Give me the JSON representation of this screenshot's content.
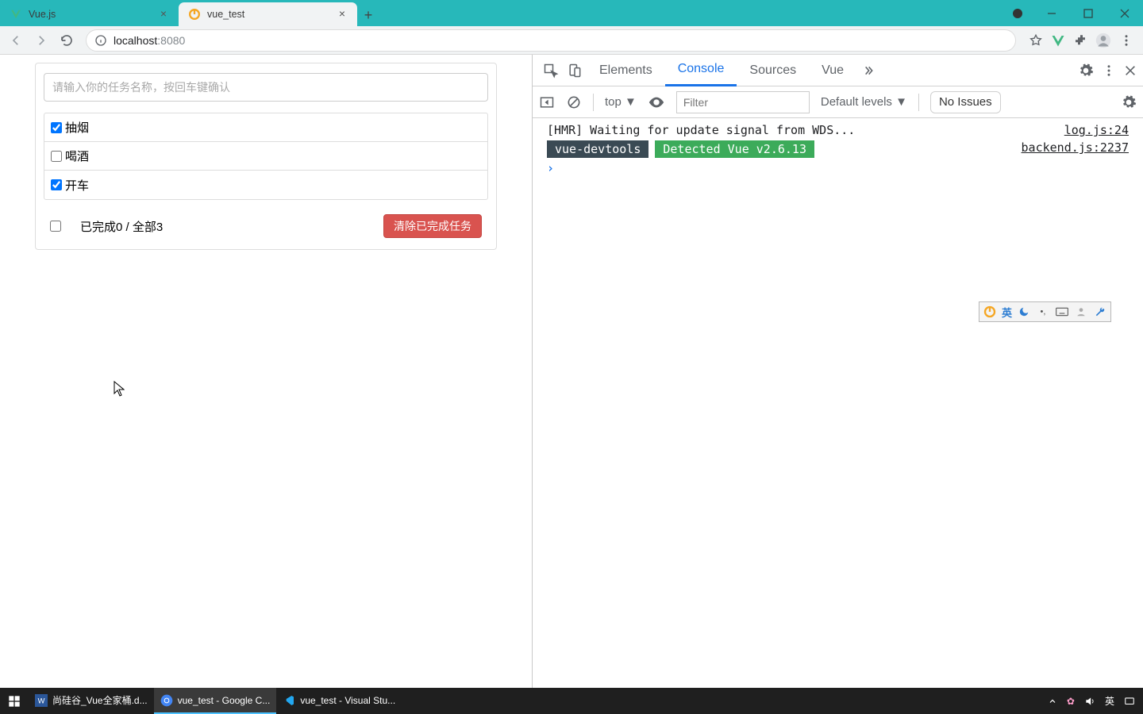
{
  "browser": {
    "tabs": [
      {
        "title": "Vue.js",
        "active": false
      },
      {
        "title": "vue_test",
        "active": true
      }
    ],
    "url_host": "localhost",
    "url_port": ":8080"
  },
  "todo": {
    "placeholder": "请输入你的任务名称，按回车键确认",
    "items": [
      {
        "label": "抽烟",
        "checked": true
      },
      {
        "label": "喝酒",
        "checked": false
      },
      {
        "label": "开车",
        "checked": true
      }
    ],
    "summary": "已完成0 / 全部3",
    "clear_label": "清除已完成任务"
  },
  "devtools": {
    "tabs": {
      "elements": "Elements",
      "console": "Console",
      "sources": "Sources",
      "vue": "Vue"
    },
    "toolbar": {
      "context": "top ▼",
      "filter_placeholder": "Filter",
      "levels": "Default levels ▼",
      "issues": "No Issues"
    },
    "logs": [
      {
        "left": "[HMR] Waiting for update signal from WDS...",
        "right": "log.js:24"
      },
      {
        "badge1": "vue-devtools",
        "badge2": "Detected Vue v2.6.13",
        "right": "backend.js:2237"
      }
    ],
    "prompt": "›"
  },
  "ime": {
    "lang": "英"
  },
  "taskbar": {
    "items": [
      {
        "label": "尚硅谷_Vue全家桶.d..."
      },
      {
        "label": "vue_test - Google C..."
      },
      {
        "label": "vue_test - Visual Stu..."
      }
    ],
    "tray_lang": "英"
  }
}
